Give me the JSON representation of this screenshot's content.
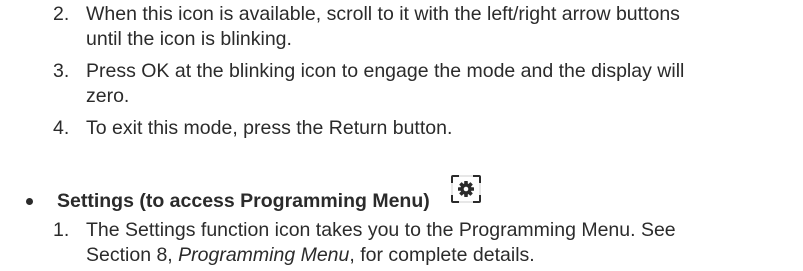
{
  "steps_top": [
    {
      "number": "2.",
      "lines": [
        "When this icon is available, scroll to it with the left/right arrow buttons",
        "until the icon is blinking."
      ]
    },
    {
      "number": "3.",
      "lines": [
        "Press OK at the blinking icon to engage the mode and the display will",
        "zero."
      ]
    },
    {
      "number": "4.",
      "lines": [
        "To exit this mode, press the Return button."
      ]
    }
  ],
  "bullet": {
    "heading": "Settings (to access Programming Menu)",
    "icon": "settings-gear-icon"
  },
  "steps_bottom": [
    {
      "number": "1.",
      "line1": "The Settings function icon takes you to the Programming Menu. See",
      "line2_prefix": "Section 8, ",
      "line2_italic": "Programming Menu",
      "line2_suffix": ", for complete details."
    }
  ],
  "colors": {
    "text": "#2b2b2b",
    "background": "#ffffff"
  }
}
